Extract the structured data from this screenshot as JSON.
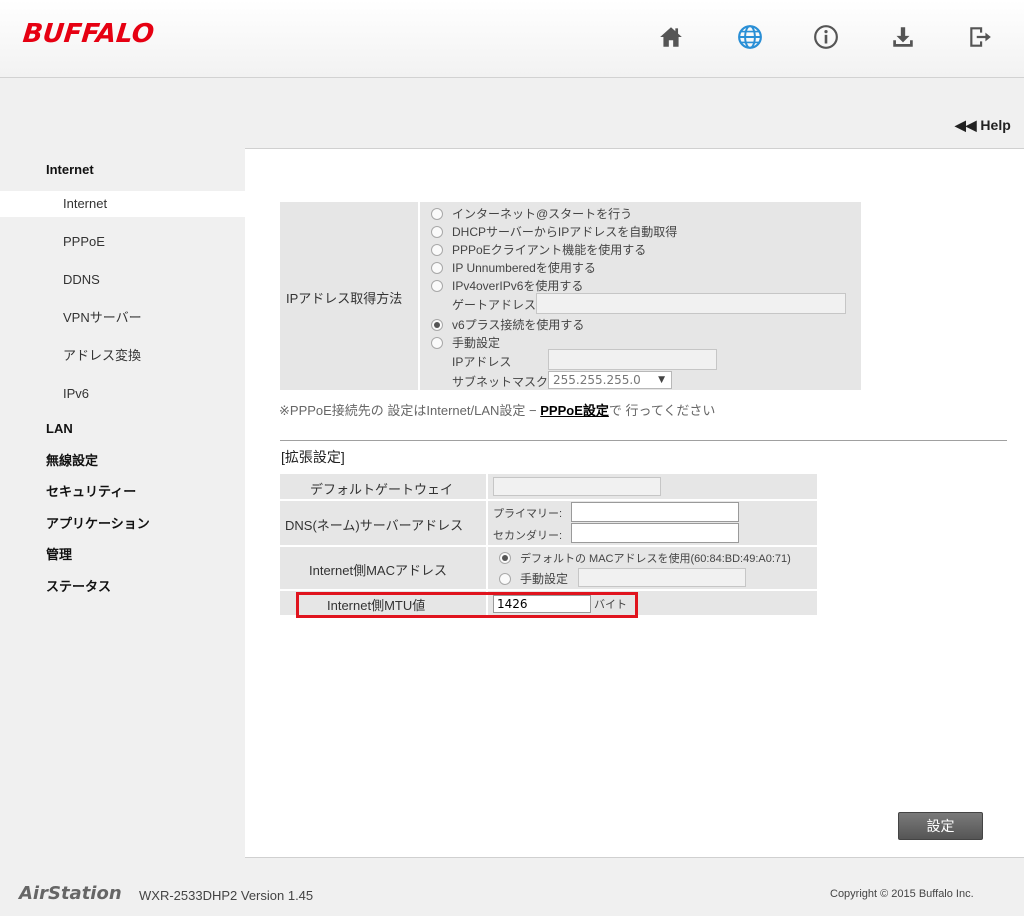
{
  "header": {
    "logo": "BUFFALO",
    "icons": [
      "home-icon",
      "globe-icon",
      "info-icon",
      "download-icon",
      "logout-icon"
    ],
    "accent": "#e60012",
    "globe_color": "#2a8fd6"
  },
  "help": {
    "label": "◀◀ Help"
  },
  "sidebar": {
    "items": [
      {
        "label": "Internet",
        "type": "category"
      },
      {
        "label": "Internet",
        "type": "sub",
        "active": true
      },
      {
        "label": "PPPoE",
        "type": "sub"
      },
      {
        "label": "DDNS",
        "type": "sub"
      },
      {
        "label": "VPNサーバー",
        "type": "sub"
      },
      {
        "label": "アドレス変換",
        "type": "sub"
      },
      {
        "label": "IPv6",
        "type": "sub"
      },
      {
        "label": "LAN",
        "type": "category"
      },
      {
        "label": "無線設定",
        "type": "category"
      },
      {
        "label": "セキュリティー",
        "type": "category"
      },
      {
        "label": "アプリケーション",
        "type": "category"
      },
      {
        "label": "管理",
        "type": "category"
      },
      {
        "label": "ステータス",
        "type": "category"
      }
    ]
  },
  "ip_method": {
    "label": "IPアドレス取得方法",
    "options": [
      "インターネット@スタートを行う",
      "DHCPサーバーからIPアドレスを自動取得",
      "PPPoEクライアント機能を使用する",
      "IP Unnumberedを使用する",
      "IPv4overIPv6を使用する",
      "v6プラス接続を使用する",
      "手動設定"
    ],
    "selected": 5,
    "gateway_label": "ゲートアドレス",
    "ip_label": "IPアドレス",
    "subnet_label": "サブネットマスク",
    "subnet_value": "255.255.255.0",
    "select_arrow": "▼"
  },
  "note": {
    "prefix": "※PPPoE接続先の 設定はInternet/LAN設定 − ",
    "link": "PPPoE設定",
    "suffix": "で 行ってください"
  },
  "extended": {
    "title": "[拡張設定]",
    "default_gateway_label": "デフォルトゲートウェイ",
    "dns_label": "DNS(ネーム)サーバーアドレス",
    "primary_label": "プライマリー:",
    "secondary_label": "セカンダリー:",
    "mac_label": "Internet側MACアドレス",
    "mac_default_option": "デフォルトの MACアドレスを使用(60:84:BD:49:A0:71)",
    "mac_manual_option": "手動設定",
    "mtu_label": "Internet側MTU値",
    "mtu_value": "1426",
    "mtu_unit": "バイト"
  },
  "submit_label": "設定",
  "footer": {
    "brand": "AirStation",
    "model": "WXR-2533DHP2   Version 1.45",
    "copyright": "Copyright © 2015 Buffalo Inc."
  },
  "highlight_color": "#e0141e"
}
